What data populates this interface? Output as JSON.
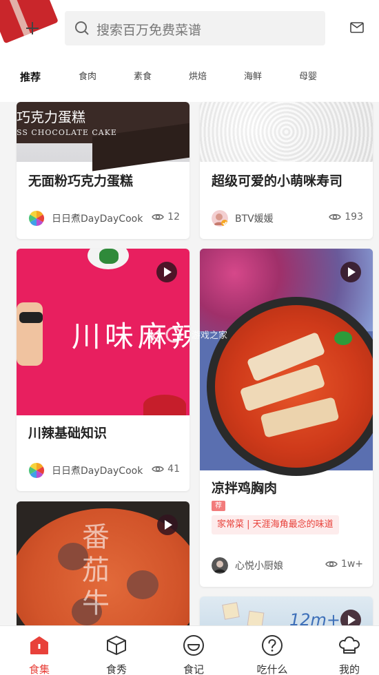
{
  "search": {
    "placeholder": "搜索百万免费菜谱"
  },
  "tabs": [
    {
      "label": "推荐",
      "active": true
    },
    {
      "label": "食肉"
    },
    {
      "label": "素食"
    },
    {
      "label": "烘焙"
    },
    {
      "label": "海鲜"
    },
    {
      "label": "母婴"
    }
  ],
  "cards": [
    {
      "title": "无面粉巧克力蛋糕",
      "image_text": "巧克力蛋糕",
      "image_subtext": "SS CHOCOLATE CAKE",
      "author": "日日煮DayDayCook",
      "views": "12"
    },
    {
      "title": "超级可爱的小萌咪寿司",
      "author": "BTV媛媛",
      "views": "193"
    },
    {
      "title": "川辣基础知识",
      "image_text": "川味麻辣",
      "author": "日日煮DayDayCook",
      "views": "41",
      "video": true
    },
    {
      "title": "凉拌鸡胸肉",
      "badge": "荐",
      "tag": "家常菜 | 天涯海角最念的味道",
      "author": "心悦小厨娘",
      "views": "1w+",
      "video": true
    },
    {
      "image_text": "番茄牛",
      "video": true
    },
    {
      "image_text": "12m+",
      "video": true
    }
  ],
  "watermark": {
    "text": "游戏之家"
  },
  "nav": [
    {
      "label": "食集",
      "icon": "home-icon",
      "active": true
    },
    {
      "label": "食秀",
      "icon": "box-icon"
    },
    {
      "label": "食记",
      "icon": "smile-icon"
    },
    {
      "label": "吃什么",
      "icon": "question-icon"
    },
    {
      "label": "我的",
      "icon": "chef-hat-icon"
    }
  ],
  "colors": {
    "accent": "#e8413a",
    "background": "#f4f4f4"
  }
}
